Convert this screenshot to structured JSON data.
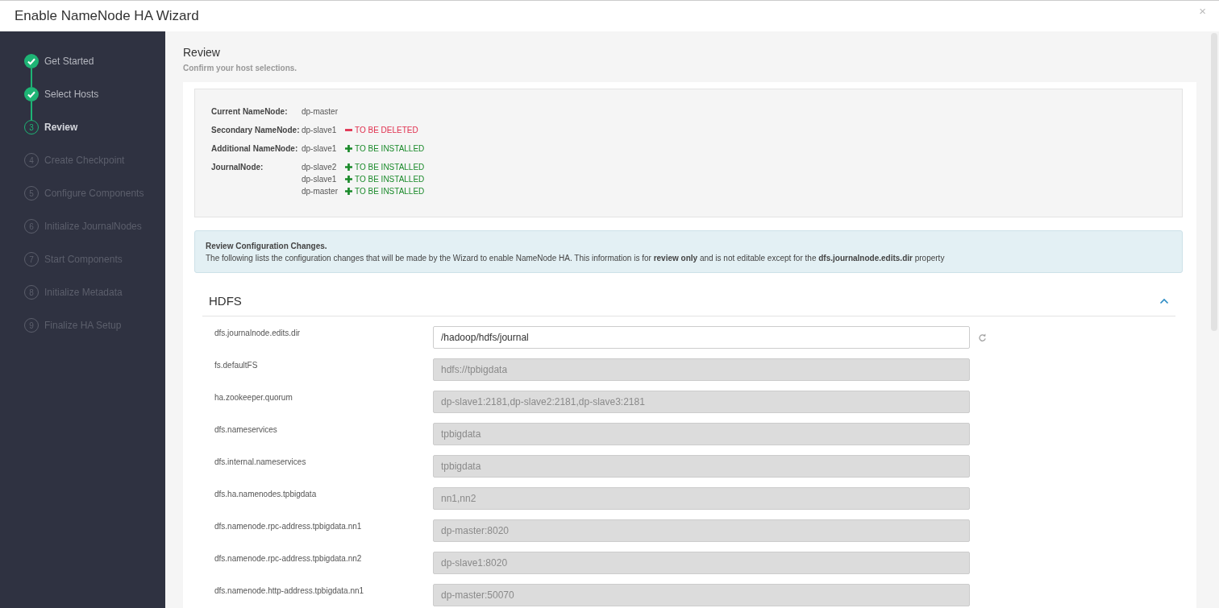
{
  "window": {
    "title": "Enable NameNode HA Wizard",
    "close": "×"
  },
  "steps": [
    {
      "label": "Get Started",
      "completed": true,
      "selected": false
    },
    {
      "label": "Select Hosts",
      "completed": true,
      "selected": false
    },
    {
      "number": "3",
      "label": "Review",
      "completed": false,
      "selected": true
    },
    {
      "number": "4",
      "label": "Create Checkpoint",
      "completed": false,
      "selected": false
    },
    {
      "number": "5",
      "label": "Configure Components",
      "completed": false,
      "selected": false
    },
    {
      "number": "6",
      "label": "Initialize JournalNodes",
      "completed": false,
      "selected": false
    },
    {
      "number": "7",
      "label": "Start Components",
      "completed": false,
      "selected": false
    },
    {
      "number": "8",
      "label": "Initialize Metadata",
      "completed": false,
      "selected": false
    },
    {
      "number": "9",
      "label": "Finalize HA Setup",
      "completed": false,
      "selected": false
    }
  ],
  "page": {
    "title": "Review",
    "subtitle": "Confirm your host selections."
  },
  "hosts": [
    {
      "label": "Current NameNode:",
      "entries": [
        {
          "host": "dp-master"
        }
      ]
    },
    {
      "label": "Secondary NameNode:",
      "entries": [
        {
          "host": "dp-slave1",
          "action": {
            "kind": "delete",
            "text": "TO BE DELETED"
          }
        }
      ]
    },
    {
      "label": "Additional NameNode:",
      "entries": [
        {
          "host": "dp-slave1",
          "action": {
            "kind": "install",
            "text": "TO BE INSTALLED"
          }
        }
      ]
    },
    {
      "label": "JournalNode:",
      "entries": [
        {
          "host": "dp-slave2",
          "action": {
            "kind": "install",
            "text": "TO BE INSTALLED"
          }
        },
        {
          "host": "dp-slave1",
          "action": {
            "kind": "install",
            "text": "TO BE INSTALLED"
          }
        },
        {
          "host": "dp-master",
          "action": {
            "kind": "install",
            "text": "TO BE INSTALLED"
          }
        }
      ]
    }
  ],
  "notice": {
    "title": "Review Configuration Changes.",
    "text": "The following lists the configuration changes that will be made by the Wizard to enable NameNode HA. This information is for **review only** and is not editable except for the **dfs.journalnode.edits.dir** property"
  },
  "section": {
    "title": "HDFS",
    "expanded": true
  },
  "properties": [
    {
      "label": "dfs.journalnode.edits.dir",
      "value": "/hadoop/hdfs/journal",
      "editable": true
    },
    {
      "label": "fs.defaultFS",
      "value": "hdfs://tpbigdata",
      "editable": false
    },
    {
      "label": "ha.zookeeper.quorum",
      "value": "dp-slave1:2181,dp-slave2:2181,dp-slave3:2181",
      "editable": false
    },
    {
      "label": "dfs.nameservices",
      "value": "tpbigdata",
      "editable": false
    },
    {
      "label": "dfs.internal.nameservices",
      "value": "tpbigdata",
      "editable": false
    },
    {
      "label": "dfs.ha.namenodes.tpbigdata",
      "value": "nn1,nn2",
      "editable": false
    },
    {
      "label": "dfs.namenode.rpc-address.tpbigdata.nn1",
      "value": "dp-master:8020",
      "editable": false
    },
    {
      "label": "dfs.namenode.rpc-address.tpbigdata.nn2",
      "value": "dp-slave1:8020",
      "editable": false
    },
    {
      "label": "dfs.namenode.http-address.tpbigdata.nn1",
      "value": "dp-master:50070",
      "editable": false
    }
  ]
}
